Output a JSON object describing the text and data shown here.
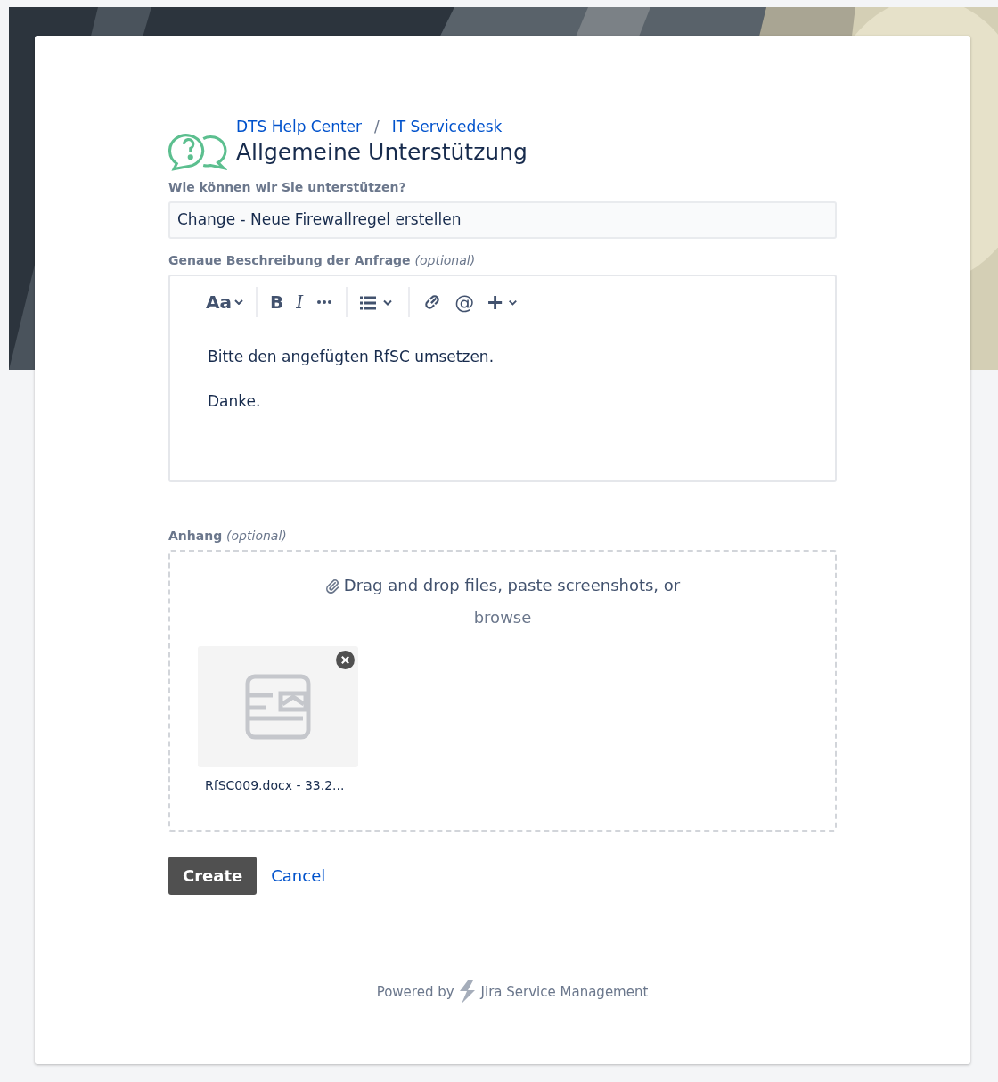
{
  "breadcrumbs": [
    "DTS Help Center",
    "IT Servicedesk"
  ],
  "breadcrumb_separator": "/",
  "title": "Allgemeine Unterstützung",
  "summary": {
    "label": "Wie können wir Sie unterstützen?",
    "value": "Change - Neue Firewallregel erstellen"
  },
  "description": {
    "label": "Genaue Beschreibung der Anfrage",
    "optional": "(optional)",
    "toolbar": [
      {
        "kind": "text-style",
        "label": "Aa"
      },
      {
        "kind": "bold",
        "label": "B"
      },
      {
        "kind": "italic",
        "label": "I"
      },
      {
        "kind": "more"
      },
      {
        "kind": "list"
      },
      {
        "kind": "link"
      },
      {
        "kind": "mention",
        "label": "@"
      },
      {
        "kind": "insert"
      }
    ],
    "paragraphs": [
      "Bitte den angefügten RfSC umsetzen.",
      "Danke."
    ]
  },
  "attachment": {
    "label": "Anhang",
    "optional": "(optional)",
    "drop_text": "Drag and drop files, paste screenshots, or",
    "browse": "browse",
    "files": [
      {
        "name": "RfSC009.docx - 33.2..."
      }
    ]
  },
  "buttons": {
    "create": "Create",
    "cancel": "Cancel"
  },
  "footer": {
    "prefix": "Powered by",
    "product": "Jira Service Management"
  }
}
